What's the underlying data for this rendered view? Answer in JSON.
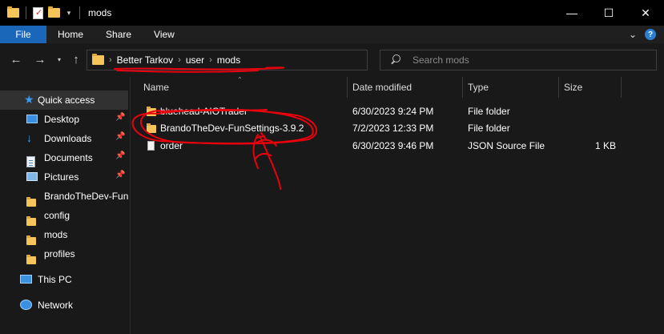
{
  "window": {
    "title": "mods",
    "controls": {
      "minimize": "—",
      "maximize": "☐",
      "close": "✕"
    }
  },
  "ribbon": {
    "tabs": [
      "File",
      "Home",
      "Share",
      "View"
    ],
    "expand": "⌄",
    "help": "?"
  },
  "nav": {
    "back": "←",
    "forward": "→",
    "recent": "▾",
    "up": "↑",
    "breadcrumb": [
      "Better Tarkov",
      "user",
      "mods"
    ],
    "search_placeholder": "Search mods"
  },
  "sidebar": {
    "quick_access": "Quick access",
    "pinned": [
      {
        "label": "Desktop",
        "icon": "desktop-icon"
      },
      {
        "label": "Downloads",
        "icon": "downloads-icon"
      },
      {
        "label": "Documents",
        "icon": "documents-icon"
      },
      {
        "label": "Pictures",
        "icon": "pictures-icon"
      }
    ],
    "folders": [
      "BrandoTheDev-Fun",
      "config",
      "mods",
      "profiles"
    ],
    "this_pc": "This PC",
    "network": "Network"
  },
  "columns": {
    "name": "Name",
    "date": "Date modified",
    "type": "Type",
    "size": "Size"
  },
  "files": [
    {
      "name": "bluehead-AIOTrader",
      "date": "6/30/2023 9:24 PM",
      "type": "File folder",
      "size": "",
      "icon": "folder-icon"
    },
    {
      "name": "BrandoTheDev-FunSettings-3.9.2",
      "date": "7/2/2023 12:33 PM",
      "type": "File folder",
      "size": "",
      "icon": "folder-icon"
    },
    {
      "name": "order",
      "date": "6/30/2023 9:46 PM",
      "type": "JSON Source File",
      "size": "1 KB",
      "icon": "file-icon"
    }
  ],
  "colors": {
    "accent": "#1a66b8",
    "annotation": "#e8000d",
    "folder": "#f6c55a",
    "background": "#191919"
  }
}
